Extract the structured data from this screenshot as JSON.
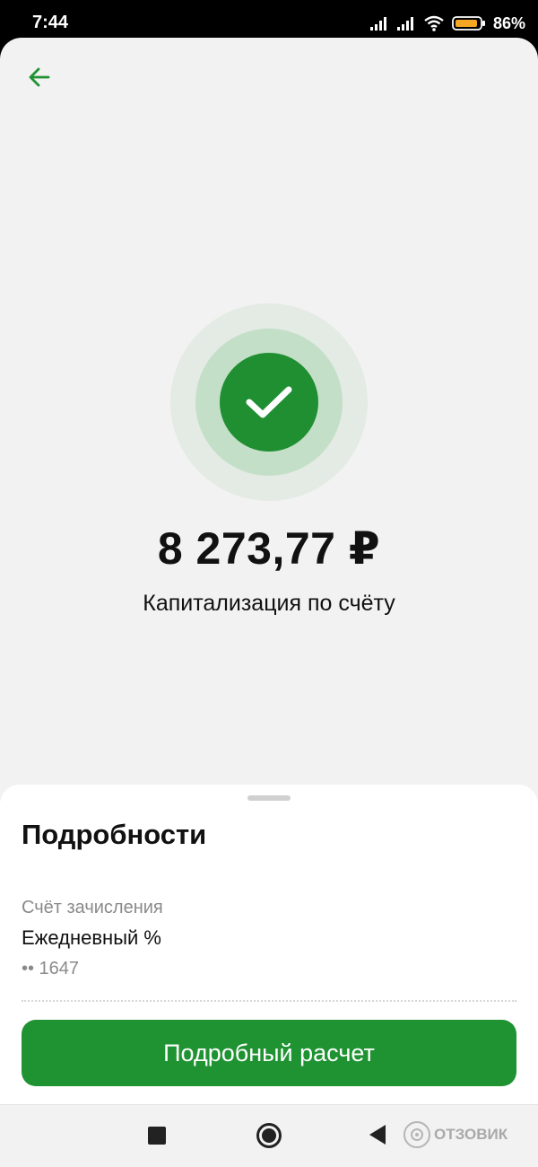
{
  "status_bar": {
    "time": "7:44",
    "battery_percent": "86",
    "battery_suffix": "%",
    "icons": [
      "signal-icon",
      "signal-icon",
      "wifi-icon",
      "battery-icon"
    ]
  },
  "header": {
    "back_icon": "arrow-left-icon"
  },
  "result": {
    "status_icon": "check-icon",
    "amount": "8 273,77 ₽",
    "title": "Капитализация по счёту"
  },
  "details": {
    "title": "Подробности",
    "account_label": "Счёт зачисления",
    "account_name": "Ежедневный %",
    "account_number": "•• 1647",
    "button_label": "Подробный расчет"
  },
  "nav_bar": {
    "icons": [
      "recents-icon",
      "home-icon",
      "back-icon"
    ]
  },
  "watermark": {
    "text": "ОТЗОВИК"
  },
  "colors": {
    "accent": "#1f9232",
    "ring_light": "#e3ebe4",
    "ring_mid": "#c4dfc8",
    "background": "#f2f2f2"
  }
}
